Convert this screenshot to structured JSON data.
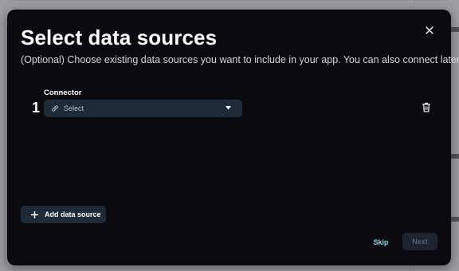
{
  "modal": {
    "title": "Select data sources",
    "subtitle": "(Optional) Choose existing data sources you want to include in your app. You can also connect later.",
    "close_icon": "close-icon"
  },
  "connector": {
    "label": "Connector",
    "index": "1",
    "placeholder": "Select",
    "left_icon": "link-icon",
    "caret_icon": "caret-down-icon",
    "delete_icon": "trash-icon"
  },
  "actions": {
    "add_label": "Add data source",
    "add_icon": "plus-icon",
    "skip_label": "Skip",
    "next_label": "Next",
    "next_disabled": true
  },
  "colors": {
    "modal_bg": "#0b0b0f",
    "control_bg": "#1f2a38",
    "accent_link": "#8fd8e8",
    "disabled_text": "#5a6270"
  }
}
